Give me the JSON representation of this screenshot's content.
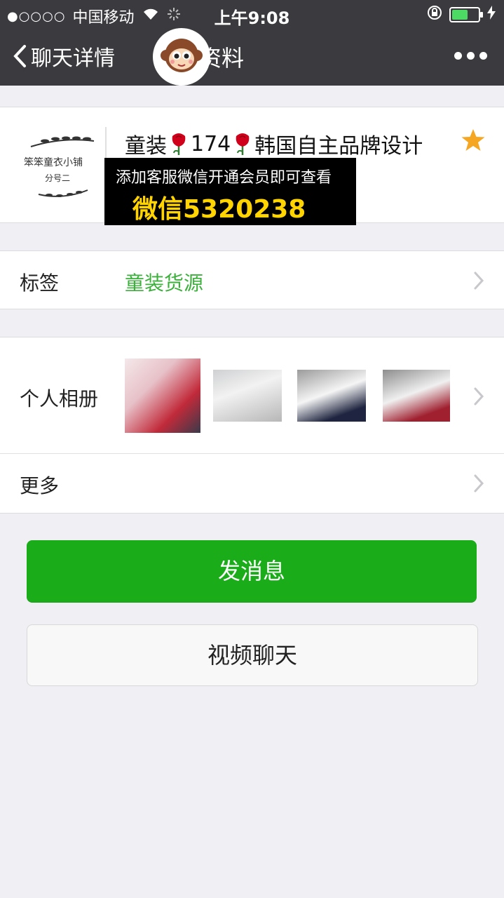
{
  "status_bar": {
    "signal_dots": "●○○○○",
    "carrier": "中国移动",
    "time": "上午9:08",
    "battery_level": 0.6
  },
  "nav": {
    "back_label": "聊天详情",
    "title": "详细资料"
  },
  "profile": {
    "name_part1": "童装",
    "name_number": "174",
    "name_part2": "韩国自主品牌设计",
    "logo_text_line1": "笨笨童衣小铺",
    "logo_text_line2": "分号二",
    "overlay_line1": "添加客服微信开通会员即可查看",
    "overlay_line2": "微信5320238"
  },
  "tags_row": {
    "label": "标签",
    "value": "童装货源"
  },
  "album_row": {
    "label": "个人相册"
  },
  "more_row": {
    "label": "更多"
  },
  "buttons": {
    "send_message": "发消息",
    "video_chat": "视频聊天"
  },
  "colors": {
    "nav_bg": "#3a3a3f",
    "accent_green": "#1aad19",
    "tag_green": "#3bb13b",
    "overlay_text": "#ffd400",
    "star": "#f5a623"
  }
}
